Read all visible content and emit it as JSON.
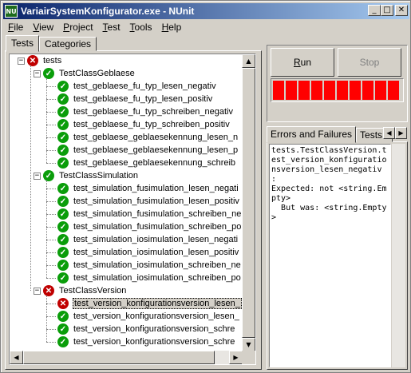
{
  "window": {
    "title": "VariairSystemKonfigurator.exe - NUnit",
    "app_icon_text": "NU",
    "minimize_glyph": "_",
    "maximize_glyph": "□",
    "close_glyph": "✕"
  },
  "menu": {
    "file_u": "F",
    "file_rest": "ile",
    "view_u": "V",
    "view_rest": "iew",
    "project_u": "P",
    "project_rest": "roject",
    "test_u": "T",
    "test_rest": "est",
    "tools_u": "T",
    "tools_rest": "ools",
    "help_u": "H",
    "help_rest": "elp"
  },
  "left_tabs": {
    "tests": "Tests",
    "categories": "Categories"
  },
  "tree": {
    "nodes": [
      {
        "label": "tests",
        "status": "fail",
        "level": 0,
        "expander": "−"
      },
      {
        "label": "TestClassGeblaese",
        "status": "pass",
        "level": 1,
        "expander": "−"
      },
      {
        "label": "test_geblaese_fu_typ_lesen_negativ",
        "status": "pass",
        "level": 2
      },
      {
        "label": "test_geblaese_fu_typ_lesen_positiv",
        "status": "pass",
        "level": 2
      },
      {
        "label": "test_geblaese_fu_typ_schreiben_negativ",
        "status": "pass",
        "level": 2
      },
      {
        "label": "test_geblaese_fu_typ_schreiben_positiv",
        "status": "pass",
        "level": 2
      },
      {
        "label": "test_geblaese_geblaesekennung_lesen_n",
        "status": "pass",
        "level": 2
      },
      {
        "label": "test_geblaese_geblaesekennung_lesen_p",
        "status": "pass",
        "level": 2
      },
      {
        "label": "test_geblaese_geblaesekennung_schreib",
        "status": "pass",
        "level": 2
      },
      {
        "label": "TestClassSimulation",
        "status": "pass",
        "level": 1,
        "expander": "−"
      },
      {
        "label": "test_simulation_fusimulation_lesen_negati",
        "status": "pass",
        "level": 2
      },
      {
        "label": "test_simulation_fusimulation_lesen_positiv",
        "status": "pass",
        "level": 2
      },
      {
        "label": "test_simulation_fusimulation_schreiben_ne",
        "status": "pass",
        "level": 2
      },
      {
        "label": "test_simulation_fusimulation_schreiben_po",
        "status": "pass",
        "level": 2
      },
      {
        "label": "test_simulation_iosimulation_lesen_negati",
        "status": "pass",
        "level": 2
      },
      {
        "label": "test_simulation_iosimulation_lesen_positiv",
        "status": "pass",
        "level": 2
      },
      {
        "label": "test_simulation_iosimulation_schreiben_ne",
        "status": "pass",
        "level": 2
      },
      {
        "label": "test_simulation_iosimulation_schreiben_po",
        "status": "pass",
        "level": 2
      },
      {
        "label": "TestClassVersion",
        "status": "fail",
        "level": 1,
        "expander": "−"
      },
      {
        "label": "test_version_konfigurationsversion_lesen_",
        "status": "fail",
        "level": 2,
        "selected": true
      },
      {
        "label": "test_version_konfigurationsversion_lesen_",
        "status": "pass",
        "level": 2
      },
      {
        "label": "test_version_konfigurationsversion_schre",
        "status": "pass",
        "level": 2
      },
      {
        "label": "test_version_konfigurationsversion_schre",
        "status": "pass",
        "level": 2
      }
    ]
  },
  "buttons": {
    "run_u": "R",
    "run_rest": "un",
    "stop_label": "Stop"
  },
  "progress": {
    "fraction": 1.0,
    "color": "#ff0000",
    "state": "failed"
  },
  "right_tabs": {
    "errors": "Errors and Failures",
    "tests_not_run": "Tests No"
  },
  "error_text": "tests.TestClassVersion.test_version_konfigurationsversion_lesen_negativ :\nExpected: not <string.Empty>\n  But was: <string.Empty>",
  "colors": {
    "pass": "#0a9d0a",
    "fail": "#c00000",
    "title_start": "#0a246a",
    "title_end": "#a6caf0"
  }
}
